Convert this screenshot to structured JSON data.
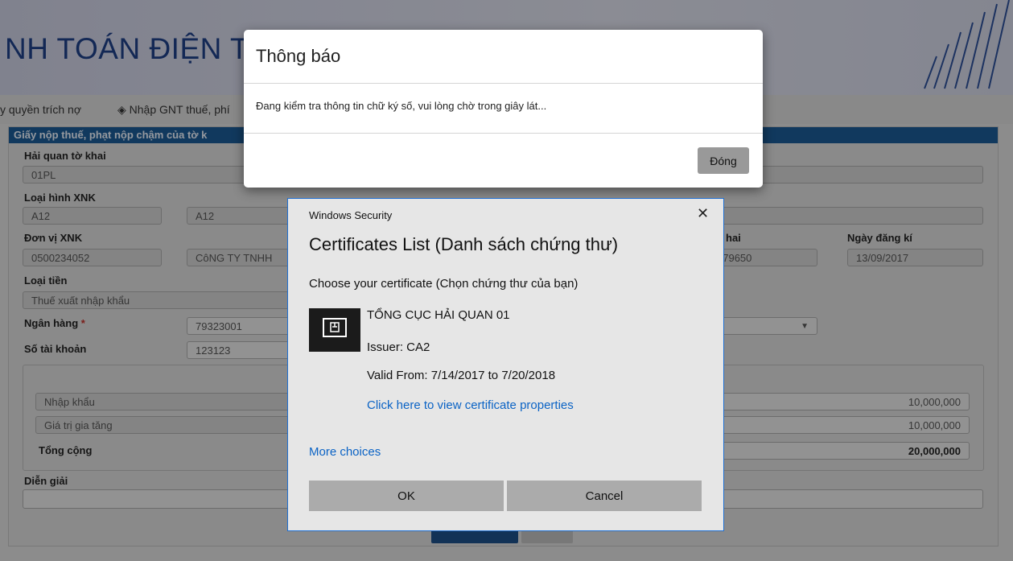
{
  "page": {
    "banner_title": "NH TOÁN ĐIỆN TỬ",
    "menu": {
      "item1": "y quyền trích nợ",
      "item2": "Nhập GNT thuế, phí"
    },
    "panel_title": "Giấy nộp thuế, phạt nộp chậm của tờ k",
    "customs_label": "Hải quan tờ khai",
    "customs_value": "01PL",
    "import_type_label": "Loại hình XNK",
    "import_type_code": "A12",
    "import_type_name": "A12",
    "unit_label": "Đơn vị XNK",
    "unit_code": "0500234052",
    "unit_name": "CôNG TY TNHH",
    "declaration_label_tail": "hai",
    "declaration_value_tail": "579650",
    "reg_date_label": "Ngày đăng kí",
    "reg_date_value": "13/09/2017",
    "currency_label": "Loại tiền",
    "currency_value": "Thuế xuất nhập khẩu",
    "bank_label": "Ngân hàng",
    "bank_required": "*",
    "bank_code": "79323001",
    "account_label": "Số tài khoản",
    "account_value": "123123",
    "rows": [
      {
        "name": "Nhập khẩu",
        "amount": "10,000,000"
      },
      {
        "name": "Giá trị gia tăng",
        "amount": "10,000,000"
      }
    ],
    "total_label": "Tổng cộng",
    "total_amount": "20,000,000",
    "desc_label": "Diễn giải"
  },
  "modal": {
    "title": "Thông báo",
    "message": "Đang kiểm tra thông tin chữ ký số, vui lòng chờ trong giây lát...",
    "close_label": "Đóng"
  },
  "windows_security": {
    "caption": "Windows Security",
    "close_glyph": "✕",
    "title": "Certificates List (Danh sách chứng thư)",
    "subtitle": "Choose your certificate (Chọn chứng thư của bạn)",
    "cert_name": "TỔNG CỤC HẢI QUAN 01",
    "issuer": "Issuer: CA2",
    "valid": "Valid From: 7/14/2017 to 7/20/2018",
    "properties_link": "Click here to view certificate properties",
    "more_choices": "More choices",
    "ok_label": "OK",
    "cancel_label": "Cancel",
    "icon": "certificate-icon"
  },
  "colors": {
    "panel_header": "#1c5a94",
    "banner_text": "#1e3f86",
    "link": "#0b63c5",
    "dialog_border": "#1f6fd1"
  }
}
